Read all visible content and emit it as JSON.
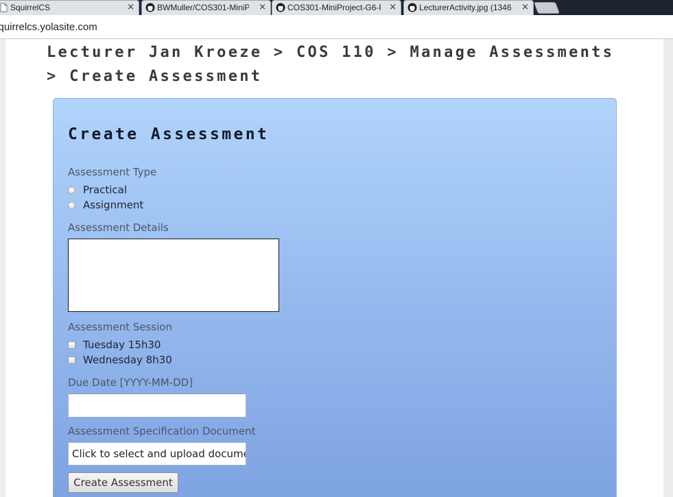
{
  "browser": {
    "tabs": [
      {
        "title": "SquirrelCS",
        "icon": "document-icon",
        "active": true
      },
      {
        "title": "BWMuller/COS301-MiniP",
        "icon": "github-icon",
        "active": false
      },
      {
        "title": "COS301-MiniProject-G6-P",
        "icon": "github-icon",
        "active": false
      },
      {
        "title": "LecturerActivity.jpg (1346",
        "icon": "github-icon",
        "active": false
      }
    ],
    "close_glyph": "×",
    "url": "squirrelcs.yolasite.com"
  },
  "page": {
    "breadcrumb": "Lecturer Jan Kroeze > COS 110 > Manage Assessments > Create Assessment"
  },
  "form": {
    "title": "Create Assessment",
    "type_label": "Assessment Type",
    "type_options": [
      "Practical",
      "Assignment"
    ],
    "details_label": "Assessment Details",
    "details_value": "",
    "session_label": "Assessment Session",
    "session_options": [
      "Tuesday 15h30",
      "Wednesday 8h30"
    ],
    "due_date_label": "Due Date [YYYY-MM-DD]",
    "due_date_value": "",
    "spec_label": "Assessment Specification Document",
    "spec_placeholder": "Click to select and upload document",
    "submit_label": "Create Assessment"
  },
  "colors": {
    "panel_top": "#b1d4fc",
    "panel_bottom": "#7ca2e1",
    "heading": "#3a3a3a",
    "tabstrip": "#1c2331"
  }
}
